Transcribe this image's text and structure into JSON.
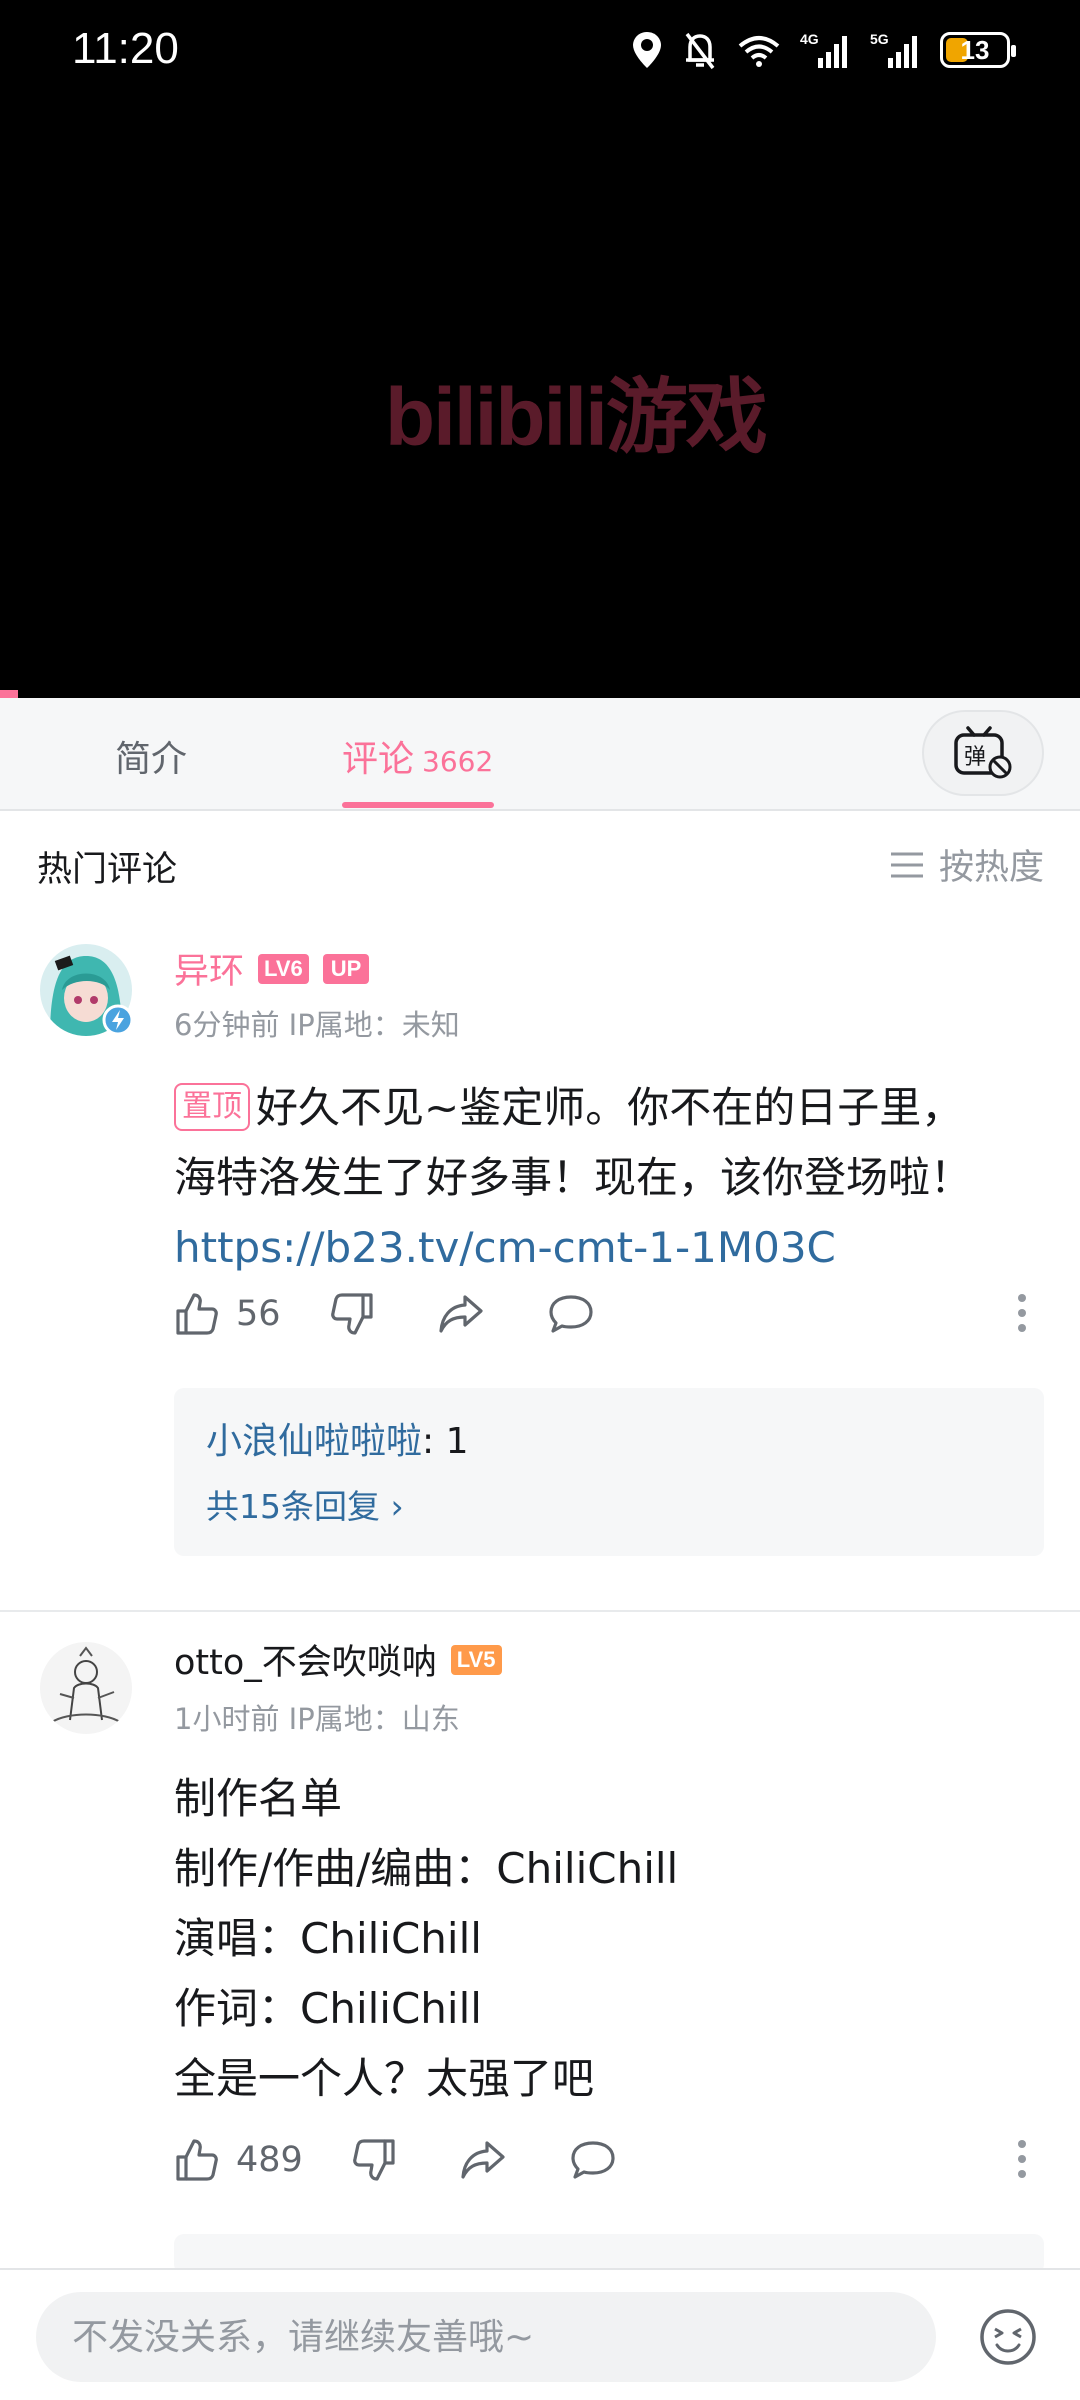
{
  "status_bar": {
    "time": "11:20",
    "battery": "13"
  },
  "video": {
    "watermark": "bilibili游戏"
  },
  "tabs": {
    "intro": "简介",
    "comments": "评论",
    "comment_count": "3662",
    "danmaku_icon": "danmaku-off-icon"
  },
  "section": {
    "title": "热门评论",
    "sort": "按热度"
  },
  "comments": [
    {
      "user": "异环",
      "level": "LV6",
      "level_color": "#fb7299",
      "up_badge": "UP",
      "meta": "6分钟前 IP属地：未知",
      "pin_tag": "置顶",
      "text_1": "好久不见~鉴定师。你不在的日子里，",
      "text_2": "海特洛发生了好多事！现在，该你登场啦！",
      "link": "https://b23.tv/cm-cmt-1-1M03C",
      "likes": "56",
      "reply_user": "小浪仙啦啦啦",
      "reply_text": ": 1",
      "reply_more": "共15条回复 ›"
    },
    {
      "user": "otto_不会吹唢呐",
      "level": "LV5",
      "level_color": "#ff9a4a",
      "meta": "1小时前 IP属地：山东",
      "lines": [
        "制作名单",
        "制作/作曲/编曲：ChiliChill",
        "演唱：ChiliChill",
        "作词：ChiliChill",
        "全是一个人？太强了吧"
      ],
      "likes": "489"
    }
  ],
  "input": {
    "placeholder": "不发没关系，请继续友善哦~"
  },
  "colors": {
    "accent": "#fb7299",
    "link": "#306b9e"
  }
}
